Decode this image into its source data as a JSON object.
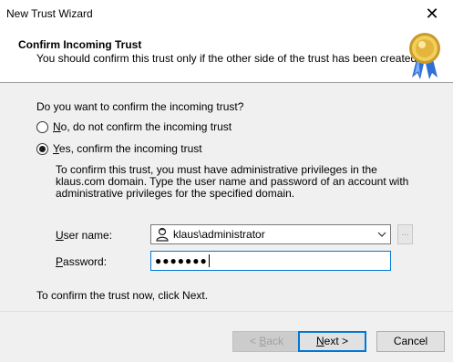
{
  "window": {
    "title": "New Trust Wizard"
  },
  "header": {
    "title": "Confirm Incoming Trust",
    "subtitle": "You should confirm this trust only if the other side of the trust has been created."
  },
  "main": {
    "question": "Do you want to confirm the incoming trust?",
    "options": [
      {
        "mnemonic": "N",
        "rest": "o, do not confirm the incoming trust",
        "checked": false
      },
      {
        "mnemonic": "Y",
        "rest": "es, confirm the incoming trust",
        "checked": true
      }
    ],
    "description": "To confirm this trust, you must have administrative privileges in the klaus.com domain. Type the user name and password of an account with administrative privileges for the specified domain.",
    "username": {
      "mnemonic": "U",
      "rest": "ser name:",
      "value": "klaus\\administrator"
    },
    "password": {
      "mnemonic": "P",
      "rest": "assword:",
      "value": "●●●●●●●"
    },
    "browse_label": "...",
    "footer": "To confirm the trust now, click Next."
  },
  "buttons": {
    "back": {
      "pre": "< ",
      "mnemonic": "B",
      "rest": "ack"
    },
    "next": {
      "mnemonic": "N",
      "rest": "ext >"
    },
    "cancel": "Cancel"
  },
  "icons": {
    "seal": "award-seal-icon",
    "user": "user-icon",
    "close": "close-icon",
    "dropdown": "chevron-down-icon"
  }
}
